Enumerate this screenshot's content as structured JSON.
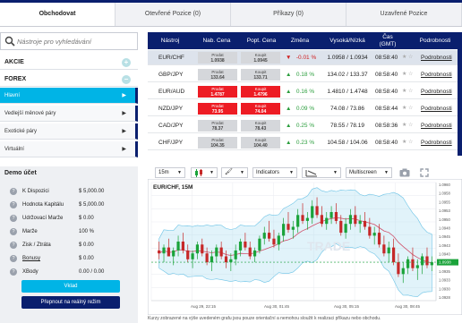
{
  "tabs": [
    "Obchodovat",
    "Otevřené Pozice (0)",
    "Příkazy (0)",
    "Uzavřené Pozice"
  ],
  "search": {
    "placeholder": "Nástroje pro vyhledávání"
  },
  "categories": [
    {
      "label": "AKCIE",
      "icon": "plus"
    },
    {
      "label": "FOREX",
      "icon": "minus"
    }
  ],
  "forex_sub": [
    {
      "label": "Hlavní",
      "active": true
    },
    {
      "label": "Vedlejší měnové páry",
      "active": false
    },
    {
      "label": "Exotické páry",
      "active": false
    },
    {
      "label": "Virtuální",
      "active": false
    }
  ],
  "account": {
    "title": "Demo účet",
    "rows": [
      {
        "label": "K Dispozici",
        "value": "$ 5,000.00",
        "link": false
      },
      {
        "label": "Hodnota Kapitálu",
        "value": "$ 5,000.00",
        "link": false
      },
      {
        "label": "Udržovací Marže",
        "value": "$ 0.00",
        "link": false
      },
      {
        "label": "Marže",
        "value": "100 %",
        "link": false
      },
      {
        "label": "Zisk / Ztráta",
        "value": "$ 0.00",
        "link": false
      },
      {
        "label": "Bonusy",
        "value": "$ 0.00",
        "link": true
      },
      {
        "label": "XBody",
        "value": "0.00 / 0.00",
        "link": false
      }
    ],
    "deposit_label": "Vklad",
    "real_label": "Přepnout na reálný režim"
  },
  "quotes": {
    "headers": [
      "Nástroj",
      "Nab. Cena",
      "Popt. Cena",
      "Změna",
      "Vysoká/Nízká",
      "Čas (GMT)",
      "Podrobnosti"
    ],
    "sell_label": "Prodat",
    "buy_label": "Koupit",
    "details_label": "Podrobnosti",
    "rows": [
      {
        "symbol": "EUR/CHF",
        "bid": "1.0938",
        "ask": "1.0945",
        "change": "-0.01 %",
        "dir": "down",
        "hl": "1.0958 / 1.0934",
        "time": "08:58:40",
        "red": false,
        "selected": true
      },
      {
        "symbol": "GBP/JPY",
        "bid": "133.64",
        "ask": "133.71",
        "change": "0.18 %",
        "dir": "up",
        "hl": "134.02 / 133.37",
        "time": "08:58:40",
        "red": false,
        "selected": false
      },
      {
        "symbol": "EUR/AUD",
        "bid": "1.4787",
        "ask": "1.4796",
        "change": "0.16 %",
        "dir": "up",
        "hl": "1.4810 / 1.4748",
        "time": "08:58:40",
        "red": true,
        "selected": false
      },
      {
        "symbol": "NZD/JPY",
        "bid": "73.95",
        "ask": "74.04",
        "change": "0.09 %",
        "dir": "up",
        "hl": "74.08 / 73.86",
        "time": "08:58:44",
        "red": true,
        "selected": false
      },
      {
        "symbol": "CAD/JPY",
        "bid": "78.37",
        "ask": "78.43",
        "change": "0.25 %",
        "dir": "up",
        "hl": "78.55 / 78.19",
        "time": "08:58:36",
        "red": false,
        "selected": false
      },
      {
        "symbol": "CHF/JPY",
        "bid": "104.35",
        "ask": "104.40",
        "change": "0.23 %",
        "dir": "up",
        "hl": "104.58 / 104.06",
        "time": "08:58:40",
        "red": false,
        "selected": false
      }
    ]
  },
  "chart_toolbar": {
    "interval": "15m",
    "indicators": "Indicators",
    "multiscreen": "Multiscreen"
  },
  "chart_data": {
    "type": "candlestick",
    "title": "EUR/CHF, 15M",
    "watermark": "TRADE",
    "ylim": [
      1.0925,
      1.0965
    ],
    "y_ticks": [
      "1.0960",
      "1.0958",
      "1.0955",
      "1.0953",
      "1.0950",
      "1.0948",
      "1.0945",
      "1.0943",
      "1.0940",
      "1.0938",
      "1.0935",
      "1.0933",
      "1.0930",
      "1.0928"
    ],
    "x_ticks": [
      "Aug 29, 22:15",
      "Aug 30, 01:45",
      "Aug 30, 05:15",
      "Aug 30, 08:45"
    ],
    "current_price": "1.0938",
    "colors": {
      "up": "#1aa33a",
      "down": "#c62828",
      "band": "#a8dcf0",
      "ma": "#d0506a"
    },
    "candles": [
      [
        1.0942,
        1.0945,
        1.0939,
        1.0941
      ],
      [
        1.0941,
        1.0944,
        1.0938,
        1.0943
      ],
      [
        1.0943,
        1.0946,
        1.094,
        1.094
      ],
      [
        1.094,
        1.0943,
        1.0937,
        1.0942
      ],
      [
        1.0942,
        1.0947,
        1.094,
        1.0945
      ],
      [
        1.0945,
        1.0948,
        1.0941,
        1.0942
      ],
      [
        1.0942,
        1.0944,
        1.0938,
        1.0939
      ],
      [
        1.0939,
        1.0942,
        1.0936,
        1.0941
      ],
      [
        1.0941,
        1.0945,
        1.0939,
        1.0944
      ],
      [
        1.0944,
        1.0946,
        1.094,
        1.0941
      ],
      [
        1.0941,
        1.0943,
        1.0937,
        1.0938
      ],
      [
        1.0938,
        1.0942,
        1.0935,
        1.094
      ],
      [
        1.094,
        1.0944,
        1.0938,
        1.0943
      ],
      [
        1.0943,
        1.0945,
        1.0939,
        1.094
      ],
      [
        1.094,
        1.0942,
        1.0936,
        1.0938
      ],
      [
        1.0938,
        1.0941,
        1.0935,
        1.0939
      ],
      [
        1.0939,
        1.0944,
        1.0937,
        1.0942
      ],
      [
        1.0942,
        1.0946,
        1.094,
        1.0945
      ],
      [
        1.0945,
        1.0948,
        1.0942,
        1.0943
      ],
      [
        1.0943,
        1.0945,
        1.0939,
        1.094
      ],
      [
        1.094,
        1.0943,
        1.0938,
        1.0942
      ],
      [
        1.0942,
        1.0947,
        1.0941,
        1.0946
      ],
      [
        1.0946,
        1.095,
        1.0944,
        1.0948
      ],
      [
        1.0948,
        1.0952,
        1.0945,
        1.0946
      ],
      [
        1.0946,
        1.0949,
        1.0943,
        1.0944
      ],
      [
        1.0944,
        1.0948,
        1.0942,
        1.0947
      ],
      [
        1.0947,
        1.0953,
        1.0945,
        1.0951
      ],
      [
        1.0951,
        1.0955,
        1.0948,
        1.0949
      ],
      [
        1.0949,
        1.0952,
        1.0946,
        1.095
      ],
      [
        1.095,
        1.0956,
        1.0948,
        1.0954
      ],
      [
        1.0954,
        1.0958,
        1.0951,
        1.0952
      ],
      [
        1.0952,
        1.0955,
        1.0949,
        1.0953
      ],
      [
        1.0953,
        1.0959,
        1.0951,
        1.0957
      ],
      [
        1.0957,
        1.096,
        1.0953,
        1.0954
      ],
      [
        1.0954,
        1.0957,
        1.095,
        1.0951
      ],
      [
        1.0951,
        1.0955,
        1.0949,
        1.0953
      ],
      [
        1.0953,
        1.0957,
        1.0951,
        1.0955
      ],
      [
        1.0955,
        1.0958,
        1.0951,
        1.0952
      ],
      [
        1.0952,
        1.0954,
        1.0947,
        1.0948
      ],
      [
        1.0948,
        1.0953,
        1.0946,
        1.0951
      ],
      [
        1.0951,
        1.0956,
        1.0949,
        1.0954
      ],
      [
        1.0954,
        1.0957,
        1.095,
        1.0951
      ],
      [
        1.0951,
        1.0954,
        1.0948,
        1.0952
      ],
      [
        1.0952,
        1.0955,
        1.0949,
        1.095
      ],
      [
        1.095,
        1.0953,
        1.0946,
        1.0947
      ],
      [
        1.0947,
        1.095,
        1.0944,
        1.0948
      ],
      [
        1.0948,
        1.0951,
        1.0943,
        1.0944
      ],
      [
        1.0944,
        1.0947,
        1.094,
        1.0941
      ],
      [
        1.0941,
        1.0945,
        1.0938,
        1.0943
      ],
      [
        1.0943,
        1.0946,
        1.0937,
        1.0938
      ],
      [
        1.0938,
        1.0941,
        1.0933,
        1.0934
      ],
      [
        1.0934,
        1.0938,
        1.0931,
        1.0936
      ],
      [
        1.0936,
        1.094,
        1.0934,
        1.0939
      ],
      [
        1.0939,
        1.0943,
        1.0935,
        1.0936
      ],
      [
        1.0936,
        1.0939,
        1.0932,
        1.0937
      ],
      [
        1.0937,
        1.0941,
        1.0934,
        1.094
      ],
      [
        1.094,
        1.0943,
        1.0936,
        1.0937
      ],
      [
        1.0937,
        1.094,
        1.0935,
        1.0938
      ]
    ]
  },
  "footer_note": "Kurzy zobrazené na výše uvedeném grafu jsou pouze orientační a nemohou sloužit k realizaci příkazu nebo obchodu."
}
